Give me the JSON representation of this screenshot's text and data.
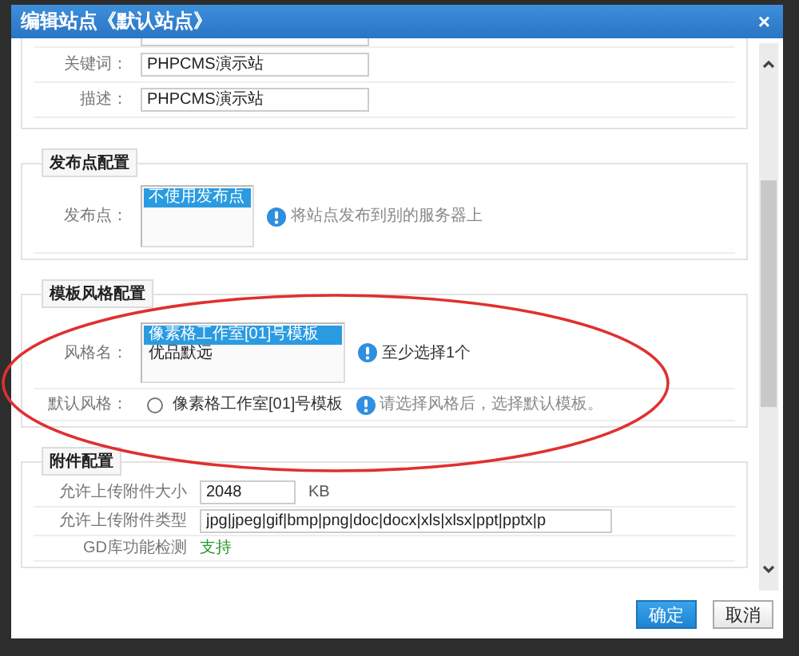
{
  "dialog": {
    "title": "编辑站点《默认站点》",
    "close": "×"
  },
  "basic_section": {
    "rows": [
      {
        "label": "关键词：",
        "value": "PHPCMS演示站"
      },
      {
        "label": "描述：",
        "value": "PHPCMS演示站"
      }
    ]
  },
  "publish_section": {
    "legend": "发布点配置",
    "label": "发布点：",
    "options": [
      {
        "label": "不使用发布点",
        "selected": true
      }
    ],
    "hint": "将站点发布到别的服务器上"
  },
  "template_section": {
    "legend": "模板风格配置",
    "style_label": "风格名：",
    "styles": [
      {
        "label": "像素格工作室[01]号模板",
        "selected": true
      },
      {
        "label": "优品默远",
        "selected": false
      }
    ],
    "style_hint": "至少选择1个",
    "default_label": "默认风格：",
    "default_option": {
      "label": "像素格工作室[01]号模板",
      "selected": false
    },
    "default_hint": "请选择风格后，选择默认模板。"
  },
  "attachment_section": {
    "legend": "附件配置",
    "rows": [
      {
        "kind": "input",
        "label": "允许上传附件大小",
        "value": "2048",
        "unit": "KB"
      },
      {
        "kind": "input",
        "label": "允许上传附件类型",
        "value": "jpg|jpeg|gif|bmp|png|doc|docx|xls|xlsx|ppt|pptx|p"
      },
      {
        "kind": "status",
        "label": "GD库功能检测",
        "value": "支持"
      }
    ]
  },
  "buttons": [
    {
      "label": "确定",
      "kind": "primary"
    },
    {
      "label": "取消",
      "kind": "default"
    }
  ]
}
